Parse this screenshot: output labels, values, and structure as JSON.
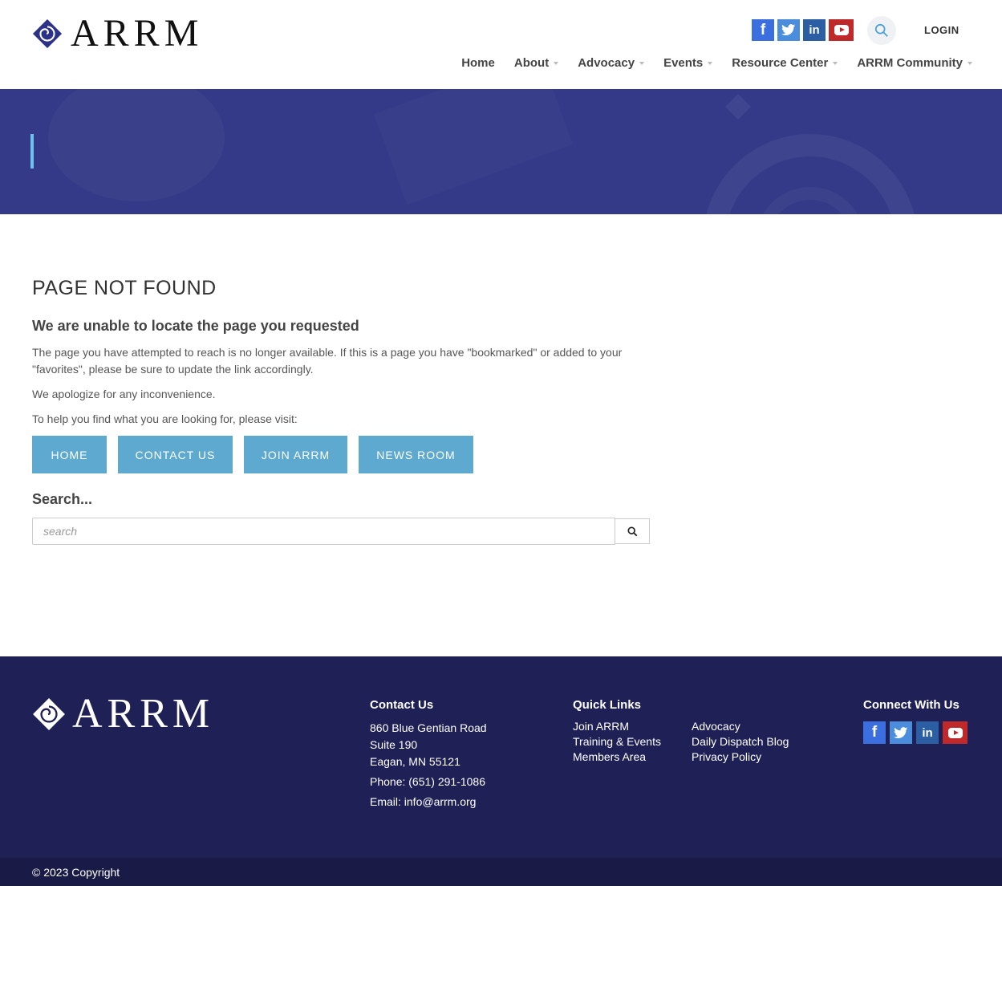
{
  "header": {
    "logo_text": "ARRM",
    "login_label": "LOGIN",
    "social": [
      {
        "name": "facebook-icon",
        "glyph": "f"
      },
      {
        "name": "twitter-icon",
        "glyph": "t"
      },
      {
        "name": "linkedin-icon",
        "glyph": "in"
      },
      {
        "name": "youtube-icon",
        "glyph": ""
      }
    ],
    "nav": [
      {
        "label": "Home",
        "has_dropdown": false
      },
      {
        "label": "About",
        "has_dropdown": true
      },
      {
        "label": "Advocacy",
        "has_dropdown": true
      },
      {
        "label": "Events",
        "has_dropdown": true
      },
      {
        "label": "Resource Center",
        "has_dropdown": true
      },
      {
        "label": "ARRM Community",
        "has_dropdown": true
      }
    ]
  },
  "main": {
    "title": "PAGE NOT FOUND",
    "subtitle": "We are unable to locate the page you requested",
    "paragraph1": "The page you have attempted to reach is no longer available. If this is a page you have \"bookmarked\" or added to your \"favorites\", please be sure to update the link accordingly.",
    "paragraph2": "We apologize for any inconvenience.",
    "paragraph3": "To help you find what you are looking for, please visit:",
    "buttons": [
      "HOME",
      "CONTACT US",
      "JOIN ARRM",
      "NEWS ROOM"
    ],
    "search_heading": "Search...",
    "search_placeholder": "search"
  },
  "footer": {
    "logo_text": "ARRM",
    "contact": {
      "heading": "Contact Us",
      "address1": "860 Blue Gentian Road",
      "address2": "Suite 190",
      "address3": "Eagan, MN 55121",
      "phone": "Phone: (651) 291-1086",
      "email": "Email: info@arrm.org"
    },
    "quick_links": {
      "heading": "Quick Links",
      "links": [
        "Join ARRM",
        "Advocacy",
        "Training & Events",
        "Daily Dispatch Blog",
        "Members Area",
        "Privacy Policy"
      ]
    },
    "connect_heading": "Connect With Us",
    "copyright": "© 2023 Copyright"
  },
  "colors": {
    "brand_navy": "#1f2056",
    "banner": "#353a88",
    "button": "#5ea9cf",
    "accent_bar": "#6ec1ee"
  }
}
